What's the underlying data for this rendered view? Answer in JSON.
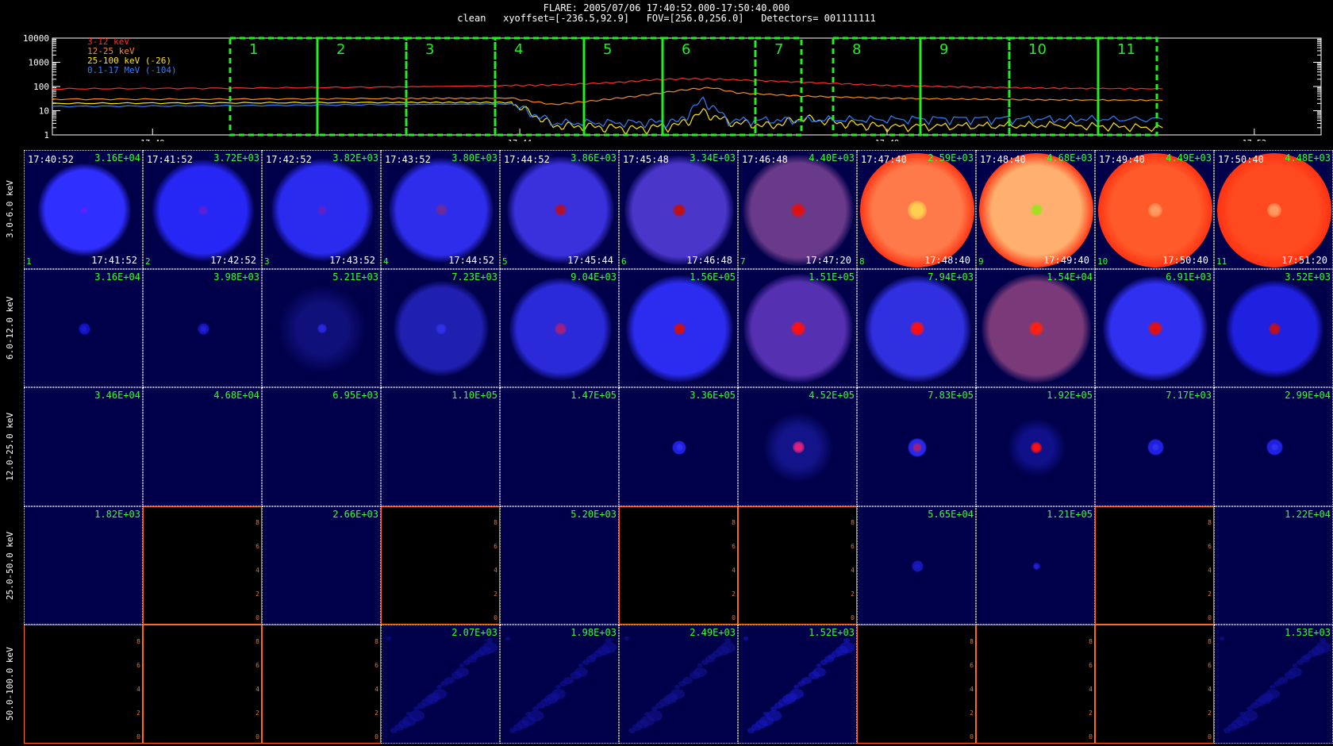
{
  "header": {
    "line1": "FLARE: 2005/07/06 17:40:52.000-17:50:40.000",
    "line2": "clean   xyoffset=[-236.5,92.9]   FOV=[256.0,256.0]   Detectors= 001111111"
  },
  "chart_data": {
    "type": "line",
    "yscale": "log",
    "ylim": [
      1,
      10000
    ],
    "yticks": [
      "10000",
      "1000",
      "100",
      "10",
      "1"
    ],
    "xticks": [
      "17:40",
      "17:44",
      "17:48",
      "17:52"
    ],
    "series": [
      {
        "name": "3-12 keV",
        "color": "#ff2a2a",
        "t": [
          0,
          2,
          4,
          5.5,
          6,
          6.8,
          7.2,
          7.6,
          8,
          9,
          10,
          11,
          12,
          13.3
        ],
        "y": [
          80,
          85,
          95,
          110,
          115,
          150,
          190,
          210,
          200,
          150,
          110,
          95,
          85,
          80
        ]
      },
      {
        "name": "12-25 keV",
        "color": "#ff8a1a",
        "t": [
          0,
          2,
          4,
          5.5,
          6,
          6.5,
          7,
          7.6,
          7.9,
          8.2,
          9,
          10,
          11,
          12,
          13.3
        ],
        "y": [
          30,
          30,
          32,
          33,
          18,
          26,
          40,
          75,
          90,
          55,
          40,
          33,
          30,
          28,
          27
        ]
      },
      {
        "name": "25-100 keV (-26)",
        "color": "#ffe600",
        "t": [
          0,
          2,
          4,
          5.5,
          6,
          6.5,
          7,
          7.5,
          7.8,
          8.1,
          8.6,
          9,
          9.5,
          10,
          11,
          12,
          13.3
        ],
        "y": [
          20,
          21,
          22,
          22,
          2.5,
          2.2,
          1.8,
          2.6,
          9,
          3.5,
          2.4,
          5,
          3,
          2.2,
          2.4,
          2.6,
          2.0
        ]
      },
      {
        "name": "0.1-17 MeV (-104)",
        "color": "#2e7fff",
        "t": [
          0,
          2,
          4,
          5.5,
          6,
          7,
          7.5,
          7.8,
          8.1,
          9,
          10,
          11,
          12,
          13.3
        ],
        "y": [
          15,
          16,
          18,
          19,
          3.2,
          3.3,
          3.5,
          30,
          4,
          4.2,
          4.5,
          4.8,
          4.6,
          4.5
        ]
      }
    ],
    "time_intervals": [
      "1",
      "2",
      "3",
      "4",
      "5",
      "6",
      "7",
      "8",
      "9",
      "10",
      "11"
    ],
    "interval_bounds_min": [
      [
        1.0,
        2.5
      ],
      [
        2.5,
        3.9
      ],
      [
        4.0,
        5.4
      ],
      [
        5.5,
        6.9
      ],
      [
        6.9,
        7.8
      ],
      [
        7.8,
        9.4
      ],
      [
        9.4,
        10.2
      ],
      [
        10.2,
        11.4
      ],
      [
        11.4,
        12.8
      ],
      [
        12.8,
        14.2
      ],
      [
        14.2,
        15.2
      ]
    ],
    "energy_bands": [
      "3.0-6.0 keV",
      "6.0-12.0 keV",
      "12.0-25.0 keV",
      "25.0-50.0 keV",
      "50.0-100.0 keV"
    ],
    "start_times": [
      "17:40:52",
      "17:41:52",
      "17:42:52",
      "17:43:52",
      "17:44:52",
      "17:45:48",
      "17:46:48",
      "17:47:40",
      "17:48:40",
      "17:49:40",
      "17:50:40"
    ],
    "end_times": [
      "17:41:52",
      "17:42:52",
      "17:43:52",
      "17:44:52",
      "17:45:44",
      "17:46:48",
      "17:47:20",
      "17:48:40",
      "17:49:40",
      "17:50:40",
      "17:51:20"
    ],
    "image_indices": [
      "1",
      "2",
      "3",
      "4",
      "5",
      "6",
      "7",
      "8",
      "9",
      "10",
      "11"
    ],
    "peaks": [
      [
        "3.16E+04",
        "3.72E+03",
        "3.82E+03",
        "3.80E+03",
        "3.86E+03",
        "3.34E+03",
        "4.40E+03",
        "2.59E+03",
        "4.68E+03",
        "4.49E+03",
        "4.48E+03"
      ],
      [
        "3.16E+04",
        "3.98E+03",
        "5.21E+03",
        "7.23E+03",
        "9.04E+03",
        "1.56E+05",
        "1.51E+05",
        "7.94E+03",
        "1.54E+04",
        "6.91E+03",
        "3.52E+03"
      ],
      [
        "3.46E+04",
        "4.68E+04",
        "6.95E+03",
        "1.10E+05",
        "1.47E+05",
        "3.36E+05",
        "4.52E+05",
        "7.83E+05",
        "1.92E+05",
        "7.17E+03",
        "2.99E+04"
      ],
      [
        "1.82E+03",
        "",
        "2.66E+03",
        "",
        "5.20E+03",
        "",
        "",
        "5.65E+04",
        "1.21E+05",
        "",
        "1.22E+04"
      ],
      [
        "",
        "",
        "",
        "2.07E+03",
        "1.98E+03",
        "2.49E+03",
        "1.52E+03",
        "",
        "",
        "",
        "1.53E+03"
      ]
    ],
    "empty_axis_ticks": [
      "0",
      "2",
      "4",
      "6",
      "8"
    ],
    "cells": [
      [
        {
          "k": "blue",
          "s": 0.78,
          "c": "#2f2fff",
          "c2": 0.05,
          "core": "#6020ff"
        },
        {
          "k": "blue",
          "s": 0.85,
          "c": "#2727f5",
          "c2": 0.08,
          "core": "#5a1fd8"
        },
        {
          "k": "blue",
          "s": 0.86,
          "c": "#2b2bf0",
          "c2": 0.08,
          "core": "#5a22c8"
        },
        {
          "k": "blue",
          "s": 0.88,
          "c": "#2d2deb",
          "c2": 0.1,
          "core": "#6a2aa0"
        },
        {
          "k": "blue",
          "s": 0.9,
          "c": "#3a30dc",
          "c2": 0.1,
          "core": "#b01030"
        },
        {
          "k": "blue",
          "s": 0.92,
          "c": "#4a36c8",
          "c2": 0.11,
          "core": "#c01010"
        },
        {
          "k": "blue",
          "s": 0.93,
          "c": "#6a3a8a",
          "c2": 0.12,
          "core": "#e01010"
        },
        {
          "k": "orange",
          "s": 0.96,
          "c": "#ff7a4a",
          "c2": 0.16,
          "core": "#ffd050"
        },
        {
          "k": "orange",
          "s": 0.96,
          "c": "#ffb070",
          "c2": 0.1,
          "core": "#a0e020"
        },
        {
          "k": "orange",
          "s": 0.96,
          "c": "#ff5a2a",
          "c2": 0.12,
          "core": "#ff9a60"
        },
        {
          "k": "orange",
          "s": 0.96,
          "c": "#ff4a20",
          "c2": 0.12,
          "core": "#ff9a60"
        }
      ],
      [
        {
          "k": "dark",
          "s": 0.1,
          "c": "#1212c0",
          "c2": 0.05,
          "core": "#1a1ad0"
        },
        {
          "k": "dark",
          "s": 0.1,
          "c": "#1414b8",
          "c2": 0.06,
          "core": "#2020d0"
        },
        {
          "k": "ring",
          "s": 0.75,
          "c": "#10107a",
          "c2": 0.08,
          "core": "#2828e0"
        },
        {
          "k": "blue",
          "s": 0.8,
          "c": "#2020b0",
          "c2": 0.09,
          "core": "#3030e8"
        },
        {
          "k": "blue",
          "s": 0.86,
          "c": "#2a2ad8",
          "c2": 0.1,
          "core": "#a02080"
        },
        {
          "k": "blue",
          "s": 0.9,
          "c": "#2c2cf0",
          "c2": 0.1,
          "core": "#d01010"
        },
        {
          "k": "blue",
          "s": 0.92,
          "c": "#5530b0",
          "c2": 0.12,
          "core": "#ff1010"
        },
        {
          "k": "blue",
          "s": 0.9,
          "c": "#3030e0",
          "c2": 0.12,
          "core": "#ff1010"
        },
        {
          "k": "blue",
          "s": 0.92,
          "c": "#7a3a7a",
          "c2": 0.12,
          "core": "#ff2010"
        },
        {
          "k": "blue",
          "s": 0.88,
          "c": "#3030f0",
          "c2": 0.12,
          "core": "#e01010"
        },
        {
          "k": "blue",
          "s": 0.82,
          "c": "#2020e0",
          "c2": 0.1,
          "core": "#c01020"
        }
      ],
      [
        {
          "k": "none"
        },
        {
          "k": "none"
        },
        {
          "k": "none"
        },
        {
          "k": "none"
        },
        {
          "k": "none"
        },
        {
          "k": "dark",
          "s": 0.12,
          "c": "#2020e0",
          "c2": 0.06,
          "core": "#3030f0"
        },
        {
          "k": "ring",
          "s": 0.6,
          "c": "#14148a",
          "c2": 0.1,
          "core": "#e02080"
        },
        {
          "k": "dark",
          "s": 0.16,
          "c": "#2828e8",
          "c2": 0.08,
          "core": "#a02080"
        },
        {
          "k": "ring",
          "s": 0.5,
          "c": "#10108a",
          "c2": 0.09,
          "core": "#ff1010"
        },
        {
          "k": "dark",
          "s": 0.14,
          "c": "#2020e0",
          "c2": 0.06,
          "core": "#3030f0"
        },
        {
          "k": "dark",
          "s": 0.14,
          "c": "#2020e0",
          "c2": 0.06,
          "core": "#3030f0"
        }
      ],
      [
        {
          "k": "none"
        },
        {
          "k": "black"
        },
        {
          "k": "none"
        },
        {
          "k": "black"
        },
        {
          "k": "none"
        },
        {
          "k": "black"
        },
        {
          "k": "black"
        },
        {
          "k": "dark",
          "s": 0.1,
          "c": "#1515b0",
          "c2": 0.05,
          "core": "#1a1ac0"
        },
        {
          "k": "dark",
          "s": 0.06,
          "c": "#1818c0",
          "c2": 0.04,
          "core": "#2020d0"
        },
        {
          "k": "black"
        },
        {
          "k": "none"
        }
      ],
      [
        {
          "k": "black"
        },
        {
          "k": "black"
        },
        {
          "k": "black"
        },
        {
          "k": "noise",
          "s": 0,
          "c": "#10109a",
          "c2": 0,
          "core": "#10109a"
        },
        {
          "k": "noise",
          "s": 0,
          "c": "#10109a",
          "c2": 0,
          "core": "#10109a"
        },
        {
          "k": "noise",
          "s": 0,
          "c": "#121290",
          "c2": 0,
          "core": "#121290"
        },
        {
          "k": "noise",
          "s": 0,
          "c": "#1818c0",
          "c2": 0,
          "core": "#1818c0"
        },
        {
          "k": "black"
        },
        {
          "k": "black"
        },
        {
          "k": "black"
        },
        {
          "k": "noise",
          "s": 0,
          "c": "#10109a",
          "c2": 0,
          "core": "#10109a"
        }
      ]
    ]
  }
}
